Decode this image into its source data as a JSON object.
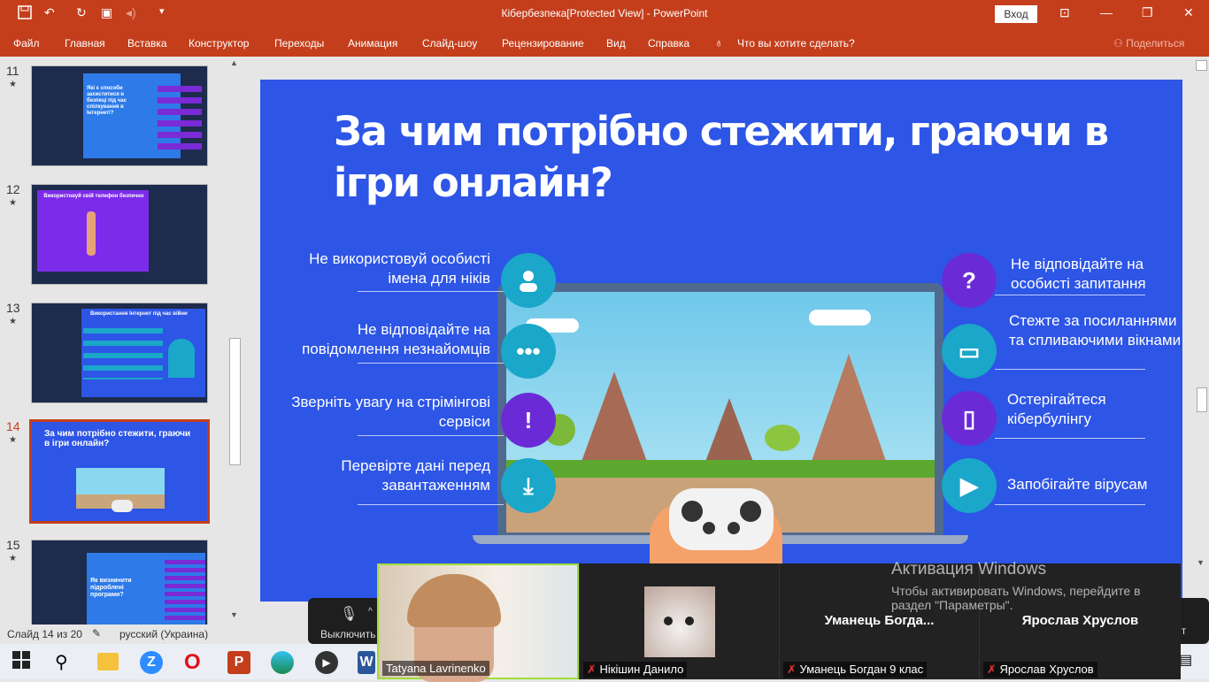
{
  "window": {
    "title": "Кібербезпека[Protected View]  -  PowerPoint",
    "login_label": "Вход"
  },
  "ribbon": {
    "tabs": [
      "Файл",
      "Главная",
      "Вставка",
      "Конструктор",
      "Переходы",
      "Анимация",
      "Слайд-шоу",
      "Рецензирование",
      "Вид",
      "Справка"
    ],
    "tell_me": "Что вы хотите сделать?",
    "share": "Поделиться"
  },
  "thumbnails": [
    {
      "number": "11",
      "text": "Які є способи захиститися в безпеці під час спілкування в Інтернеті?"
    },
    {
      "number": "12",
      "text": "Використовуй свій телефон безпечно"
    },
    {
      "number": "13",
      "text": "Використання Інтернет під час війни"
    },
    {
      "number": "14",
      "text": "За чим потрібно стежити, граючи в ігри онлайн?"
    },
    {
      "number": "15",
      "text": "Як визначити підроблені програми?"
    }
  ],
  "slide": {
    "title": "За чим потрібно стежити, граючи в ігри онлайн?",
    "left_tips": [
      "Не використовуй особисті імена для ніків",
      "Не відповідайте на повідомлення незнайомців",
      "Зверніть увагу на стрімінгові сервіси",
      "Перевірте дані перед завантаженням"
    ],
    "right_tips": [
      "Не відповідайте на особисті запитання",
      "Стежте за посиланнями та спливаючими вікнами",
      "Остерігайтеся кібербулінгу",
      "Запобігайте вірусам"
    ]
  },
  "status": {
    "slide_count": "Слайд 14 из 20",
    "language": "русский (Украина)"
  },
  "zoom": {
    "mute_label": "Выключить",
    "participants": [
      {
        "name": "Tatyana Lavrinenko"
      },
      {
        "name": "Нікішин Данило"
      },
      {
        "big_name": "Уманець  Богда...",
        "name": "Уманець Богдан 9 клас"
      },
      {
        "big_name": "Ярослав Хруслов",
        "name": "Ярослав Хруслов"
      }
    ],
    "truncated_right": "ит"
  },
  "windows_activation": {
    "title": "Активация Windows",
    "message": "Чтобы активировать Windows, перейдите в раздел \"Параметры\"."
  },
  "colors": {
    "accent": "#c43e1c",
    "slide_bg": "#2d55e6",
    "icon_teal": "#1aa7c9",
    "icon_purple": "#6a2bd6"
  }
}
